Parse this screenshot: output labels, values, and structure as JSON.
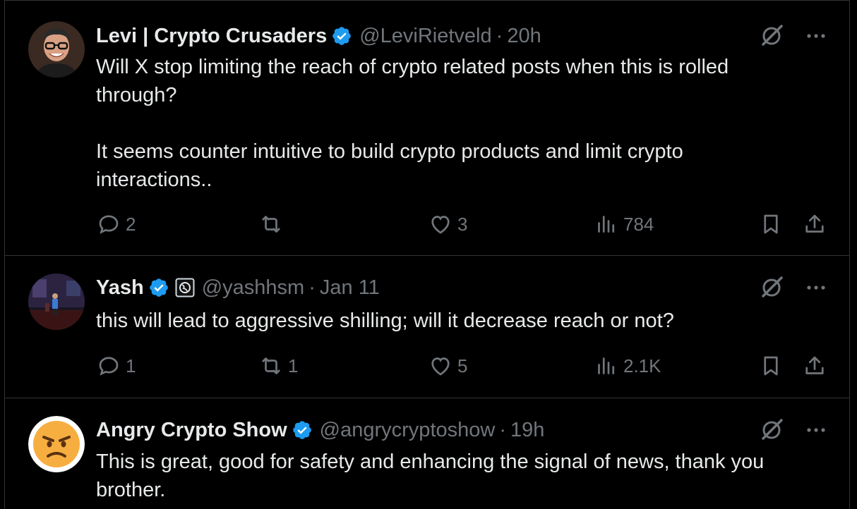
{
  "posts": [
    {
      "name": "Levi | Crypto Crusaders",
      "handle": "@LeviRietveld",
      "sep": "·",
      "time": "20h",
      "text": "Will X stop limiting the reach of crypto related posts when this is rolled through?\n\nIt seems counter intuitive to build crypto products and limit crypto interactions..",
      "replies": "2",
      "reposts": "",
      "likes": "3",
      "views": "784",
      "avatar_icon": "person-with-glasses-avatar"
    },
    {
      "name": "Yash",
      "handle": "@yashhsm",
      "sep": "·",
      "time": "Jan 11",
      "text": "this will lead to aggressive shilling; will it decrease reach or not?",
      "replies": "1",
      "reposts": "1",
      "likes": "5",
      "views": "2.1K",
      "avatar_icon": "speaker-on-stage-avatar",
      "affiliate_icon": "globe-badge-icon"
    },
    {
      "name": "Angry Crypto Show",
      "handle": "@angrycryptoshow",
      "sep": "·",
      "time": "19h",
      "text": "This is great, good for safety and enhancing the signal of news, thank you brother.",
      "avatar_icon": "angry-face-emoji-avatar"
    }
  ],
  "colors": {
    "background": "#000000",
    "text": "#e7e9ea",
    "muted": "#71767b",
    "verified": "#1d9bf0",
    "border": "#2f3336"
  }
}
